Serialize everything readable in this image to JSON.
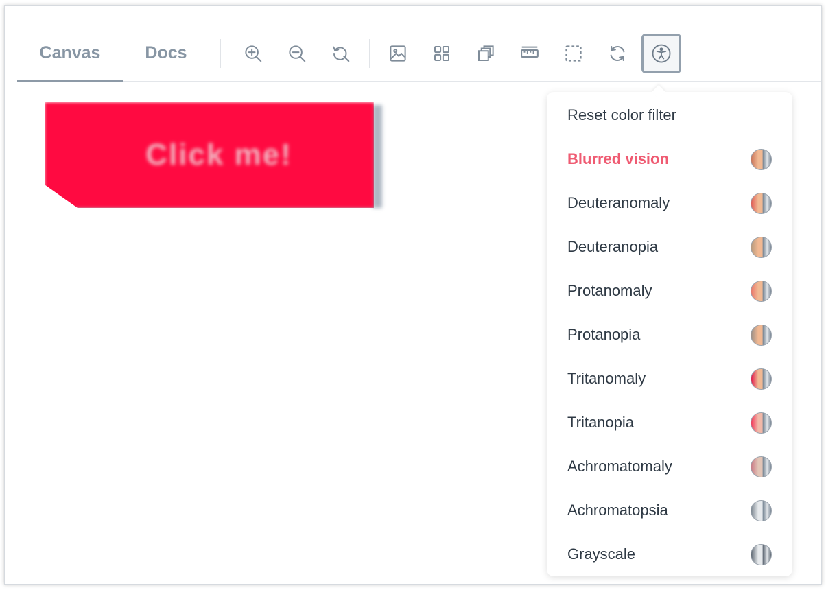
{
  "tabs": [
    {
      "label": "Canvas",
      "active": true
    },
    {
      "label": "Docs",
      "active": false
    }
  ],
  "toolbar_icons": [
    "zoom-in-icon",
    "zoom-out-icon",
    "zoom-reset-icon",
    "image-icon",
    "grid-icon",
    "layers-icon",
    "ruler-icon",
    "outline-icon",
    "refresh-icon",
    "accessibility-icon"
  ],
  "demo_button": {
    "label": "Click me!",
    "color": "#ff0a41"
  },
  "menu": {
    "reset_label": "Reset color filter",
    "items": [
      {
        "label": "Blurred vision",
        "selected": true,
        "swatch": [
          "#c9755a",
          "#f1b892",
          "#7a8896"
        ]
      },
      {
        "label": "Deuteranomaly",
        "selected": false,
        "swatch": [
          "#e05d56",
          "#f1b892",
          "#7a8896"
        ]
      },
      {
        "label": "Deuteranopia",
        "selected": false,
        "swatch": [
          "#b79a7d",
          "#f1b892",
          "#7a8896"
        ]
      },
      {
        "label": "Protanomaly",
        "selected": false,
        "swatch": [
          "#e9776a",
          "#f1b892",
          "#7a8896"
        ]
      },
      {
        "label": "Protanopia",
        "selected": false,
        "swatch": [
          "#9b8f86",
          "#f1b892",
          "#7a8896"
        ]
      },
      {
        "label": "Tritanomaly",
        "selected": false,
        "swatch": [
          "#e0194b",
          "#f1b892",
          "#7a8896"
        ]
      },
      {
        "label": "Tritanopia",
        "selected": false,
        "swatch": [
          "#f2385a",
          "#f1b8a8",
          "#7a8896"
        ]
      },
      {
        "label": "Achromatomaly",
        "selected": false,
        "swatch": [
          "#c97a86",
          "#e2c4b6",
          "#7a8896"
        ]
      },
      {
        "label": "Achromatopsia",
        "selected": false,
        "swatch": [
          "#7d8791",
          "#e6e9ec",
          "#7a8896"
        ]
      },
      {
        "label": "Grayscale",
        "selected": false,
        "swatch": [
          "#5f6974",
          "#e6e9ec",
          "#5f6974"
        ]
      }
    ]
  }
}
